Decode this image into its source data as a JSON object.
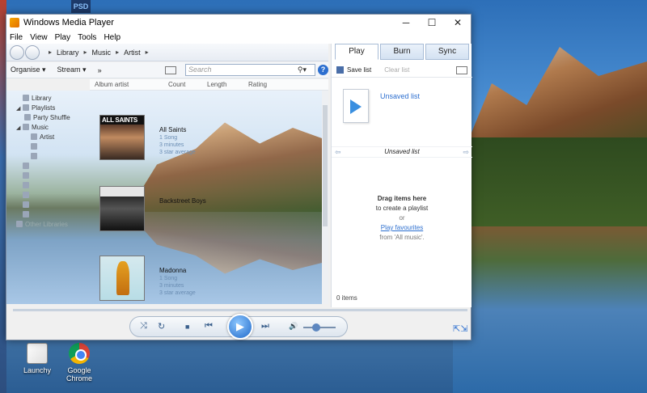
{
  "window": {
    "title": "Windows Media Player",
    "controls": [
      "─",
      "☐",
      "✕"
    ]
  },
  "menu": [
    "File",
    "View",
    "Play",
    "Tools",
    "Help"
  ],
  "breadcrumb": [
    "Library",
    "Music",
    "Artist"
  ],
  "toolbar": {
    "organise": "Organise ▾",
    "stream": "Stream ▾",
    "more": "»",
    "search_placeholder": "Search",
    "search_icon": "magnifier-icon",
    "help": "?"
  },
  "columns": [
    "Album artist",
    "Count",
    "Length",
    "Rating"
  ],
  "tree": [
    {
      "label": "Library",
      "icon": "library-icon",
      "arrow": ""
    },
    {
      "label": "Playlists",
      "icon": "playlist-icon",
      "arrow": "◢"
    },
    {
      "label": "Party Shuffle",
      "icon": "shuffle-icon",
      "arrow": ""
    },
    {
      "label": "Music",
      "icon": "music-icon",
      "arrow": "◢"
    },
    {
      "label": "Artist",
      "icon": "artist-icon",
      "arrow": ""
    },
    {
      "label": "",
      "icon": "album-icon",
      "arrow": ""
    },
    {
      "label": "",
      "icon": "genre-icon",
      "arrow": ""
    },
    {
      "label": "",
      "icon": "video-icon",
      "arrow": ""
    },
    {
      "label": "",
      "icon": "pictures-icon",
      "arrow": ""
    },
    {
      "label": "",
      "icon": "other-media-icon",
      "arrow": ""
    },
    {
      "label": "",
      "icon": "recorded-tv-icon",
      "arrow": ""
    },
    {
      "label": "",
      "icon": "star-icon",
      "arrow": ""
    },
    {
      "label": "",
      "icon": "other-library-icon",
      "arrow": ""
    },
    {
      "label": "Other Libraries",
      "icon": "network-icon",
      "arrow": ""
    }
  ],
  "albums": [
    {
      "artist": "All Saints",
      "count": "1 Song",
      "length": "3 minutes",
      "rating": "3 star average",
      "cover": "cover-allsaints"
    },
    {
      "artist": "Backstreet Boys",
      "count": "",
      "length": "",
      "rating": "",
      "cover": "cover-bsb"
    },
    {
      "artist": "Madonna",
      "count": "1 Song",
      "length": "3 minutes",
      "rating": "3 star average",
      "cover": "cover-madonna"
    }
  ],
  "tabs": [
    "Play",
    "Burn",
    "Sync"
  ],
  "right_pane": {
    "save_list": "Save list",
    "clear_list": "Clear list",
    "unsaved_title": "Unsaved list",
    "list_name": "Unsaved list",
    "drag_line1": "Drag items here",
    "drag_line2": "to create a playlist",
    "or": "or",
    "play_favourites": "Play favourites",
    "from_all_music": "from 'All music'.",
    "items_count": "0 items"
  },
  "player": {
    "shuffle": "⤨",
    "repeat": "↻",
    "stop": "■",
    "prev": "⏮",
    "play": "▶",
    "next": "⏭",
    "mute": "🔊",
    "volume_fraction": 0.4
  },
  "desktop": {
    "icons": [
      "Launchy",
      "Google Chrome"
    ],
    "badge": "PSD"
  },
  "colors": {
    "accent": "#2d6fcf",
    "meta_text": "#6a8db3"
  }
}
